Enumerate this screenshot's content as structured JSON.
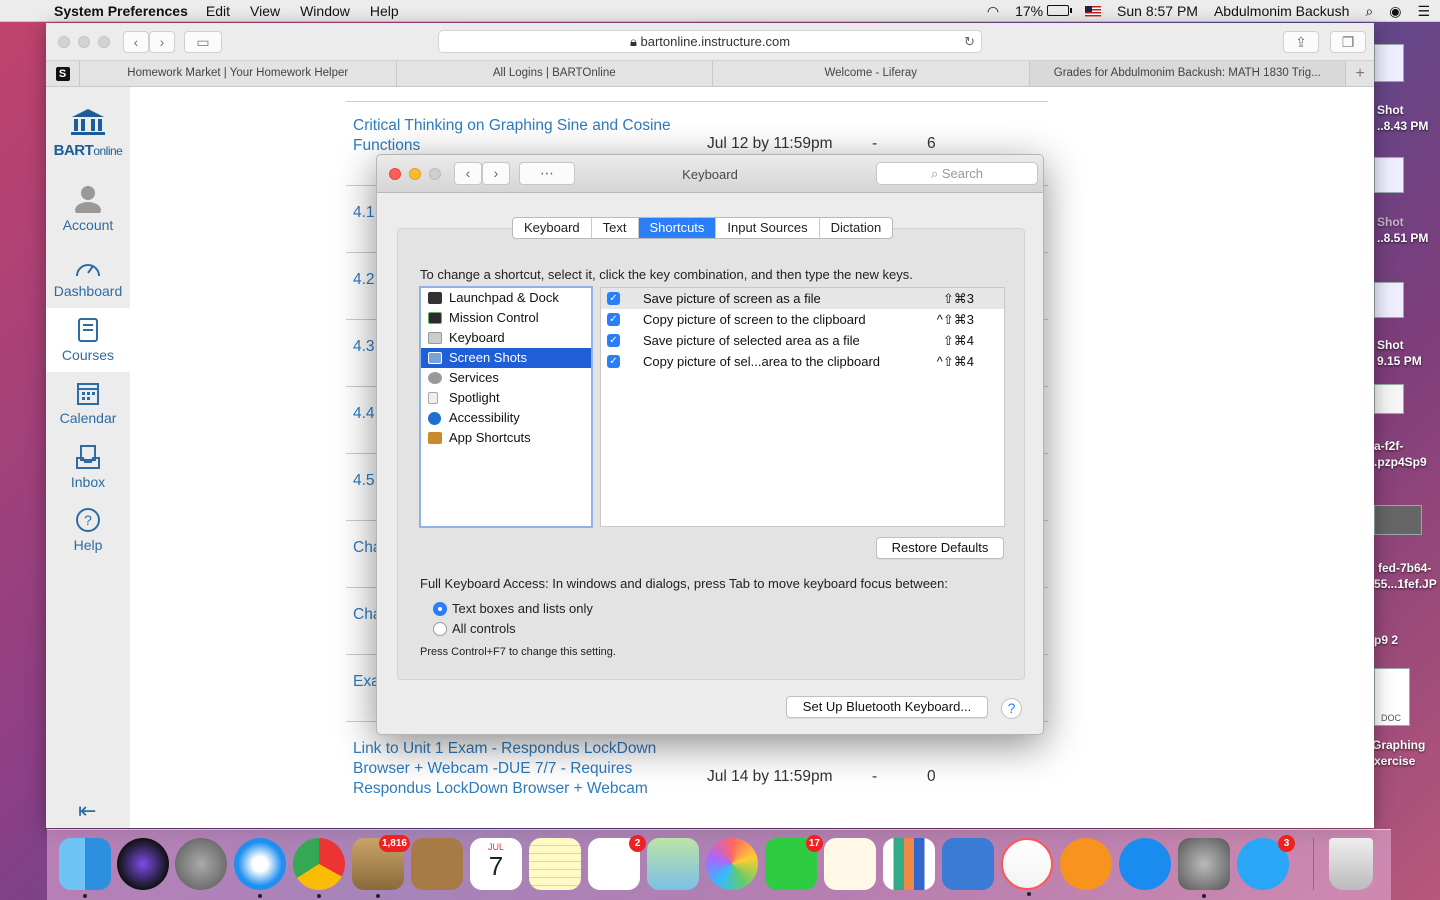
{
  "menubar": {
    "app": "System Preferences",
    "items": [
      "Edit",
      "View",
      "Window",
      "Help"
    ],
    "battery": "17%",
    "clock": "Sun 8:57 PM",
    "user": "Abdulmonim Backush"
  },
  "browser": {
    "url": "bartonline.instructure.com",
    "tabs": [
      "Homework Market | Your Homework Helper",
      "All Logins | BARTOnline",
      "Welcome - Liferay",
      "Grades for Abdulmonim Backush: MATH 1830 Trig..."
    ],
    "favicon": "S"
  },
  "canvas_nav": {
    "logo_main": "BART",
    "logo_sub": "online",
    "items": [
      {
        "label": "Account",
        "icon": "account-icon"
      },
      {
        "label": "Dashboard",
        "icon": "dashboard-icon"
      },
      {
        "label": "Courses",
        "icon": "courses-icon"
      },
      {
        "label": "Calendar",
        "icon": "calendar-icon"
      },
      {
        "label": "Inbox",
        "icon": "inbox-icon"
      },
      {
        "label": "Help",
        "icon": "help-icon"
      }
    ]
  },
  "modules": {
    "first": {
      "title_line1": "Critical Thinking on Graphing Sine and Cosine",
      "title_line2": "Functions",
      "due": "Jul 12 by 11:59pm",
      "dash": "-",
      "points": "6"
    },
    "partial": [
      "4.1",
      "4.2",
      "4.3",
      "4.4",
      "4.5",
      "Cha",
      "Cha",
      "Exa"
    ],
    "last": {
      "line1": "Link to Unit 1 Exam - Respondus LockDown",
      "line2": "Browser + Webcam -DUE 7/7 - Requires",
      "line3": "Respondus LockDown Browser + Webcam",
      "due": "Jul 14 by 11:59pm",
      "dash": "-",
      "points": "0"
    }
  },
  "desktop": {
    "labels": [
      "Shot",
      "..8.43 PM",
      "Shot",
      "..8.51 PM",
      "Shot",
      "9.15 PM",
      "a-f2f-",
      ".pzp4Sp9",
      "fed-7b64-",
      "55...1fef.JP",
      "p9 2",
      "Graphing",
      "xercise"
    ],
    "doc_tag": "DOC"
  },
  "prefs": {
    "title": "Keyboard",
    "search_placeholder": "Search",
    "tabs": [
      "Keyboard",
      "Text",
      "Shortcuts",
      "Input Sources",
      "Dictation"
    ],
    "active_tab": "Shortcuts",
    "instruction": "To change a shortcut, select it, click the key combination, and then type the new keys.",
    "categories": [
      {
        "label": "Launchpad & Dock",
        "icon": "launchpad-icon",
        "color": "#333"
      },
      {
        "label": "Mission Control",
        "icon": "mission-control-icon",
        "color": "#2a2a2a"
      },
      {
        "label": "Keyboard",
        "icon": "keyboard-icon",
        "color": "#bbb"
      },
      {
        "label": "Screen Shots",
        "icon": "screenshot-icon",
        "color": "#7aa0d8"
      },
      {
        "label": "Services",
        "icon": "gear-icon",
        "color": "#999"
      },
      {
        "label": "Spotlight",
        "icon": "spotlight-icon",
        "color": "#ddd"
      },
      {
        "label": "Accessibility",
        "icon": "accessibility-icon",
        "color": "#1f6fd1"
      },
      {
        "label": "App Shortcuts",
        "icon": "app-shortcuts-icon",
        "color": "#c88a2a"
      }
    ],
    "selected_category": "Screen Shots",
    "shortcuts": [
      {
        "label": "Save picture of screen as a file",
        "keys": "⇧⌘3",
        "checked": true
      },
      {
        "label": "Copy picture of screen to the clipboard",
        "keys": "^⇧⌘3",
        "checked": true
      },
      {
        "label": "Save picture of selected area as a file",
        "keys": "⇧⌘4",
        "checked": true
      },
      {
        "label": "Copy picture of sel...area to the clipboard",
        "keys": "^⇧⌘4",
        "checked": true
      }
    ],
    "restore_button": "Restore Defaults",
    "fka_text": "Full Keyboard Access: In windows and dialogs, press Tab to move keyboard focus between:",
    "radio_options": [
      "Text boxes and lists only",
      "All controls"
    ],
    "radio_selected": "Text boxes and lists only",
    "hint": "Press Control+F7 to change this setting.",
    "bluetooth_button": "Set Up Bluetooth Keyboard...",
    "help_button": "?"
  },
  "dock": {
    "badges": {
      "mail": "1,816",
      "reminders": "2",
      "facetime": "17",
      "messages": "3"
    },
    "calendar_month": "JUL",
    "calendar_day": "7"
  }
}
